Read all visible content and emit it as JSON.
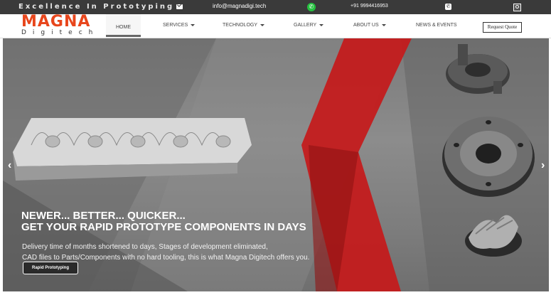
{
  "topbar": {
    "tagline": "Excellence In Prototyping",
    "email": "info@magnadigi.tech",
    "phone": "+91 9994416953",
    "icons": {
      "mail": "mail-icon",
      "whatsapp": "whatsapp-icon",
      "phone": "phone-icon",
      "search": "search-icon"
    },
    "whatsapp_color": "#25c13f"
  },
  "logo": {
    "main": "MAGNA",
    "sub": "Digitech",
    "color": "#e8461c"
  },
  "nav": {
    "items": [
      {
        "label": "HOME",
        "active": true,
        "dropdown": false
      },
      {
        "label": "SERVICES",
        "active": false,
        "dropdown": true
      },
      {
        "label": "TECHNOLOGY",
        "active": false,
        "dropdown": true
      },
      {
        "label": "GALLERY",
        "active": false,
        "dropdown": true
      },
      {
        "label": "ABOUT US",
        "active": false,
        "dropdown": true
      },
      {
        "label": "NEWS & EVENTS",
        "active": false,
        "dropdown": false
      }
    ],
    "quote_button": "Request Quote"
  },
  "hero": {
    "headline_1": "NEWER... BETTER... QUICKER...",
    "headline_2": "GET YOUR RAPID PROTOTYPE COMPONENTS IN DAYS",
    "description_1": "Delivery time of months shortened to days, Stages of development eliminated,",
    "description_2": "CAD files to Parts/Components with no hard tooling, this is what Magna Digitech offers you.",
    "cta_label": "Rapid Prototyping",
    "prev_arrow": "‹",
    "next_arrow": "›",
    "slide_count": 5,
    "active_slide": 1,
    "accent_color": "#d0191b"
  }
}
